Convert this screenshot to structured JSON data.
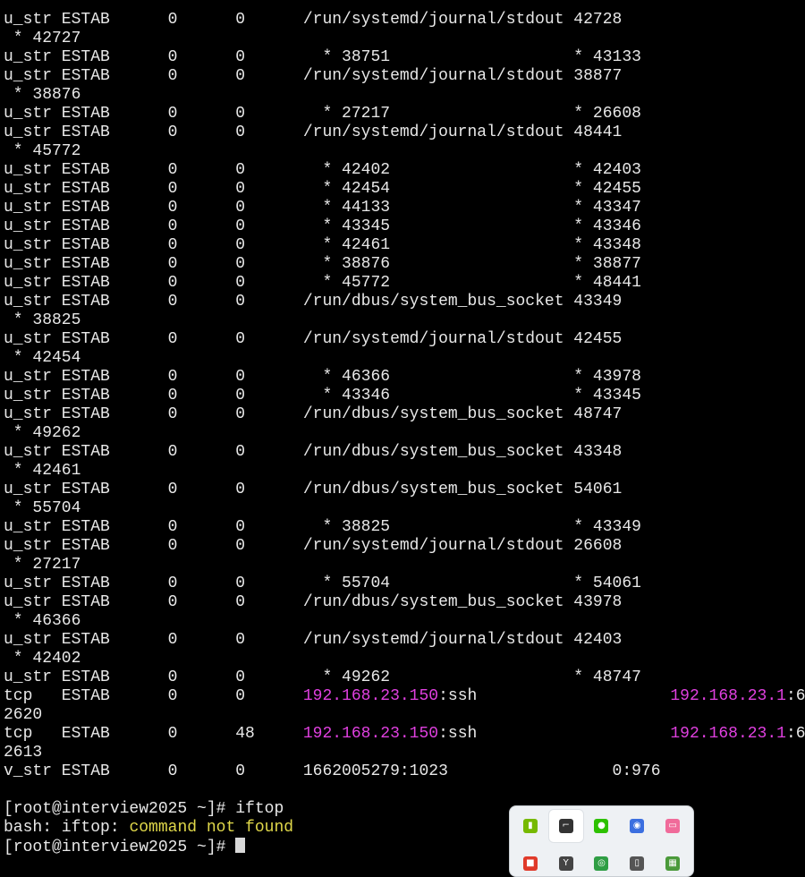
{
  "terminal": {
    "lines": [
      {
        "t": "u_str ESTAB      0      0      /run/systemd/journal/stdout 42728"
      },
      {
        "t": " * 42727"
      },
      {
        "t": "u_str ESTAB      0      0        * 38751                   * 43133"
      },
      {
        "t": "u_str ESTAB      0      0      /run/systemd/journal/stdout 38877"
      },
      {
        "t": " * 38876"
      },
      {
        "t": "u_str ESTAB      0      0        * 27217                   * 26608"
      },
      {
        "t": "u_str ESTAB      0      0      /run/systemd/journal/stdout 48441"
      },
      {
        "t": " * 45772"
      },
      {
        "t": "u_str ESTAB      0      0        * 42402                   * 42403"
      },
      {
        "t": "u_str ESTAB      0      0        * 42454                   * 42455"
      },
      {
        "t": "u_str ESTAB      0      0        * 44133                   * 43347"
      },
      {
        "t": "u_str ESTAB      0      0        * 43345                   * 43346"
      },
      {
        "t": "u_str ESTAB      0      0        * 42461                   * 43348"
      },
      {
        "t": "u_str ESTAB      0      0        * 38876                   * 38877"
      },
      {
        "t": "u_str ESTAB      0      0        * 45772                   * 48441"
      },
      {
        "t": "u_str ESTAB      0      0      /run/dbus/system_bus_socket 43349"
      },
      {
        "t": " * 38825"
      },
      {
        "t": "u_str ESTAB      0      0      /run/systemd/journal/stdout 42455"
      },
      {
        "t": " * 42454"
      },
      {
        "t": "u_str ESTAB      0      0        * 46366                   * 43978"
      },
      {
        "t": "u_str ESTAB      0      0        * 43346                   * 43345"
      },
      {
        "t": "u_str ESTAB      0      0      /run/dbus/system_bus_socket 48747"
      },
      {
        "t": " * 49262"
      },
      {
        "t": "u_str ESTAB      0      0      /run/dbus/system_bus_socket 43348"
      },
      {
        "t": " * 42461"
      },
      {
        "t": "u_str ESTAB      0      0      /run/dbus/system_bus_socket 54061"
      },
      {
        "t": " * 55704"
      },
      {
        "t": "u_str ESTAB      0      0        * 38825                   * 43349"
      },
      {
        "t": "u_str ESTAB      0      0      /run/systemd/journal/stdout 26608"
      },
      {
        "t": " * 27217"
      },
      {
        "t": "u_str ESTAB      0      0        * 55704                   * 54061"
      },
      {
        "t": "u_str ESTAB      0      0      /run/dbus/system_bus_socket 43978"
      },
      {
        "t": " * 46366"
      },
      {
        "t": "u_str ESTAB      0      0      /run/systemd/journal/stdout 42403"
      },
      {
        "t": " * 42402"
      },
      {
        "t": "u_str ESTAB      0      0        * 49262                   * 48747"
      },
      {
        "pre": "tcp   ESTAB      0      0      ",
        "ip": "192.168.23.150",
        "mid": ":ssh                    ",
        "ip2": "192.168.23.1",
        "post": ":6"
      },
      {
        "t": "2620"
      },
      {
        "pre": "tcp   ESTAB      0      48     ",
        "ip": "192.168.23.150",
        "mid": ":ssh                    ",
        "ip2": "192.168.23.1",
        "post": ":6"
      },
      {
        "t": "2613"
      },
      {
        "t": "v_str ESTAB      0      0      1662005279:1023                 0:976"
      },
      {
        "t": ""
      },
      {
        "t": "[root@interview2025 ~]# iftop"
      },
      {
        "pre": "bash: iftop: ",
        "err": "command not found"
      },
      {
        "t": "[root@interview2025 ~]# ",
        "cursor": true
      }
    ],
    "colors": {
      "foreground": "#e8e8e8",
      "background": "#000000",
      "ip_highlight": "#e040e0",
      "error_text": "#e0d84a"
    }
  },
  "tray": {
    "items": [
      {
        "name": "nvidia-icon",
        "glyph": "▮",
        "color": "#76b900",
        "active": false
      },
      {
        "name": "pointer-tool-icon",
        "glyph": "⌐",
        "color": "#333333",
        "active": true
      },
      {
        "name": "wechat-icon",
        "glyph": "●",
        "color": "#2dc100",
        "active": false
      },
      {
        "name": "app-icon",
        "glyph": "◉",
        "color": "#3b6fe0",
        "active": false
      },
      {
        "name": "bilibili-icon",
        "glyph": "▭",
        "color": "#f06b9a",
        "active": false
      },
      {
        "name": "red-app-icon",
        "glyph": "■",
        "color": "#e03a2a",
        "active": false
      },
      {
        "name": "y-app-icon",
        "glyph": "Y",
        "color": "#444444",
        "active": false
      },
      {
        "name": "chrome-icon",
        "glyph": "◎",
        "color": "#2f9e44",
        "active": false
      },
      {
        "name": "usb-icon",
        "glyph": "▯",
        "color": "#555555",
        "active": false
      },
      {
        "name": "grid-app-icon",
        "glyph": "▦",
        "color": "#4a9a3a",
        "active": false
      }
    ]
  }
}
